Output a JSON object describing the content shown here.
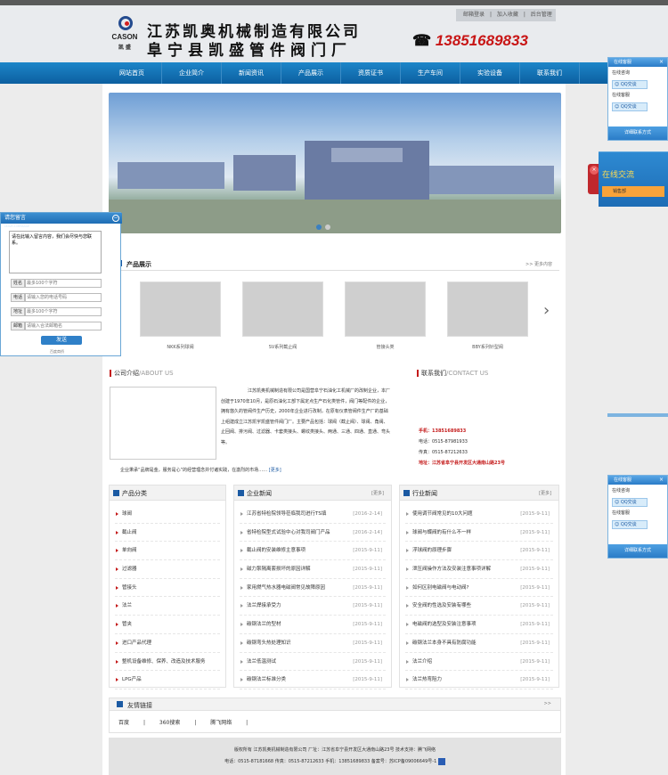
{
  "header": {
    "logo_en": "CASON",
    "logo_cn": "凯 盛",
    "company1": "江苏凯奥机械制造有限公司",
    "company2": "阜宁县凯盛管件阀门厂",
    "phone": "13851689833",
    "toplinks": [
      "邮箱登录",
      "|",
      "加入收藏",
      "|",
      "后台管理"
    ]
  },
  "nav": [
    "网站首页",
    "企业简介",
    "新闻资讯",
    "产品展示",
    "资质证书",
    "生产车间",
    "实验设备",
    "联系我们"
  ],
  "products": {
    "title": "产品展示",
    "more": ">> 更多内容",
    "items": [
      "NKK系列球阀",
      "SV系列截止阀",
      "管接头类",
      "BBY系列针型阀"
    ]
  },
  "about": {
    "title": "公司介绍",
    "en": "/ABOUT US",
    "text": "江苏凯奥机械制造有限公司是国营阜宁石油化工机械厂的改制企业，本厂创建于1970年10月，是原石油化工部下属定点生产石化类管件，阀门等配件的企业，拥有悠久的管阀件生产历史，2000年企业进行改制，在原有仪表管阀件生产厂的基础上组建成立江苏凯宇凯盛管件阀门厂。主要产品包括：球阀（截止阀）、球阀、角阀、止回阀、排污阀、过滤器、卡套类接头、螺纹类接头、两通、三通、四通、直通、弯头等。",
    "last": "企业秉承“品牌是金，服务是心”的经营理念并付诸实践，在激烈的市场……",
    "more": "[更多]"
  },
  "contact": {
    "title": "联系我们",
    "en": "/CONTACT US",
    "mobile": "手机：13851689833",
    "tel": "电话：0515-87981933",
    "fax": "传真：0515-87212633",
    "addr": "地址：江苏省阜宁县开发区大通南山路23号"
  },
  "categories": {
    "title": "产品分类",
    "items": [
      "球阀",
      "截止阀",
      "单向阀",
      "过滤器",
      "管接头",
      "法兰",
      "管夹",
      "进口产品代理",
      "整机设备维修、保养、改造及技术服务",
      "LPG产品"
    ]
  },
  "company_news": {
    "title": "企业新闻",
    "more": "[更多]",
    "items": [
      {
        "t": "江苏省特检院领导莅临我司进行TS填",
        "d": "[2016-2-14]"
      },
      {
        "t": "省特检院型式试验中心对我司阀门产品",
        "d": "[2016-2-14]"
      },
      {
        "t": "截止阀的安装维修主意事项",
        "d": "[2015-9-11]"
      },
      {
        "t": "磁力泵隔离套损坏的原因详解",
        "d": "[2015-9-11]"
      },
      {
        "t": "家用燃气热水器电磁阀常见故障原因",
        "d": "[2015-9-11]"
      },
      {
        "t": "法兰焊接承受力",
        "d": "[2015-9-11]"
      },
      {
        "t": "碳钢法兰的型材",
        "d": "[2015-9-11]"
      },
      {
        "t": "碳钢弯头热处理知识",
        "d": "[2015-9-11]"
      },
      {
        "t": "法兰低温测试",
        "d": "[2015-9-11]"
      },
      {
        "t": "碳钢法兰标准分类",
        "d": "[2015-9-11]"
      }
    ]
  },
  "industry_news": {
    "title": "行业新闻",
    "more": "[更多]",
    "items": [
      {
        "t": "使用调节阀常见的10大问题",
        "d": "[2015-9-11]"
      },
      {
        "t": "球阀与蝶阀的有什么不一样",
        "d": "[2015-9-11]"
      },
      {
        "t": "浮球阀的原理步骤",
        "d": "[2015-9-11]"
      },
      {
        "t": "泄压阀操作方法及安装注意事项详解",
        "d": "[2015-9-11]"
      },
      {
        "t": "如何区别电磁阀与电动阀?",
        "d": "[2015-9-11]"
      },
      {
        "t": "安全阀的性选及安装有哪些",
        "d": "[2015-9-11]"
      },
      {
        "t": "电磁阀的选型及安装注意事项",
        "d": "[2015-9-11]"
      },
      {
        "t": "碳钢法兰本身不具有防腐功能",
        "d": "[2015-9-11]"
      },
      {
        "t": "法兰介绍",
        "d": "[2015-9-11]"
      },
      {
        "t": "法兰热弯阻力",
        "d": "[2015-9-11]"
      }
    ]
  },
  "links": {
    "title": "友情链接",
    "more": ">>",
    "items": [
      "百度",
      "|",
      "360搜索",
      "|",
      "腾飞网络",
      "|"
    ]
  },
  "footer": {
    "line1": "版权所有   江苏凯奥机械制造有限公司   厂址：江苏省阜宁县开发区大通南山路23号 技术支持：腾飞网络",
    "line2": "电话：0515-87181668   传真：0515-87212633   手机：13851689833   备案号：苏ICP备09006649号-1"
  },
  "message": {
    "title": "请您留言",
    "subtitle": "LEAVE A MESSAGE",
    "placeholder": "请在此输入留言内容，我们会尽快与您联系。",
    "fields": [
      {
        "label": "姓名",
        "ph": "最多100个字符"
      },
      {
        "label": "电话",
        "ph": "请输入您的电话号码"
      },
      {
        "label": "地址",
        "ph": "最多100个字符"
      },
      {
        "label": "邮箱",
        "ph": "请输入合法邮箱名"
      }
    ],
    "send": "发送",
    "baidu": "百度商桥"
  },
  "qq_panel": {
    "title": "在线客服",
    "line": "在线咨询",
    "line2": "在线客服",
    "btn": "QQ交谈",
    "footer": "详细联系方式"
  },
  "online": {
    "title": "在线交流",
    "tag": "销售部"
  }
}
